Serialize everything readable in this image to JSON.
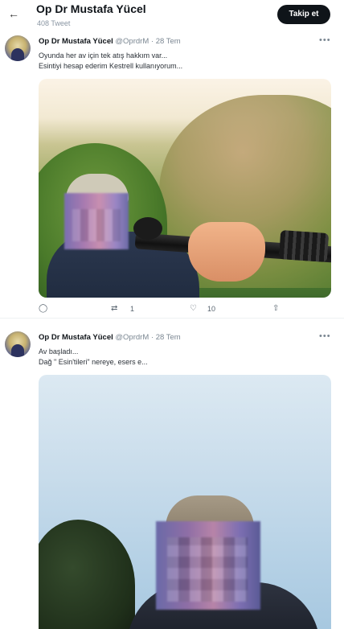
{
  "header": {
    "title": "Op Dr Mustafa Yücel",
    "tweet_count": "408 Tweet",
    "follow_label": "Takip et",
    "back_icon": "arrow-left-icon"
  },
  "tweets": [
    {
      "name": "Op Dr Mustafa Yücel",
      "handle": "@OprdrM",
      "separator": "·",
      "date": "28 Tem",
      "lines": [
        "Oyunda her av için tek atış hakkım var...",
        "Esintiyi hesap ederim Kestrell kullanıyorum..."
      ],
      "retweets": "1",
      "likes": "10"
    },
    {
      "name": "Op Dr Mustafa Yücel",
      "handle": "@OprdrM",
      "separator": "·",
      "date": "28 Tem",
      "lines": [
        "Av başladı...",
        "Dağ \" Esin'tileri\" nereye, esers e..."
      ]
    }
  ],
  "icons": {
    "more": "more-horizontal-icon",
    "reply": "reply-icon",
    "retweet": "retweet-icon",
    "like": "heart-icon",
    "share": "share-icon"
  }
}
